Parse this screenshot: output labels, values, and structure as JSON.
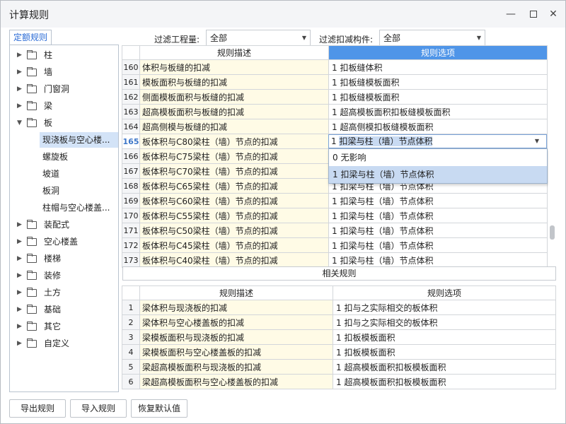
{
  "window": {
    "title": "计算规则",
    "min": "—",
    "close": "✕"
  },
  "tab": "定额规则",
  "filter": {
    "project_label": "过滤工程量:",
    "project_value": "全部",
    "member_label": "过滤扣减构件:",
    "member_value": "全部"
  },
  "tree": {
    "items": [
      "柱",
      "墙",
      "门窗洞",
      "梁",
      "板",
      "装配式",
      "空心楼盖",
      "楼梯",
      "装修",
      "土方",
      "基础",
      "其它",
      "自定义"
    ],
    "children": [
      "现浇板与空心楼...",
      "螺旋板",
      "坡道",
      "板洞",
      "柱帽与空心楼盖..."
    ]
  },
  "main_table": {
    "headers": [
      "规则描述",
      "规则选项"
    ],
    "rows": [
      {
        "n": "160",
        "d": "体积与板缝的扣减",
        "o": "1  扣板缝体积"
      },
      {
        "n": "161",
        "d": "模板面积与板缝的扣减",
        "o": "1  扣板缝模板面积"
      },
      {
        "n": "162",
        "d": "侧面模板面积与板缝的扣减",
        "o": "1  扣板缝模板面积"
      },
      {
        "n": "163",
        "d": "超高模板面积与板缝的扣减",
        "o": "1  超高模板面积扣板缝模板面积"
      },
      {
        "n": "164",
        "d": "超高侧模与板缝的扣减",
        "o": "1  超高侧模扣板缝模板面积"
      },
      {
        "n": "165",
        "d": "板体积与C80梁柱（墙）节点的扣减",
        "o": ""
      },
      {
        "n": "166",
        "d": "板体积与C75梁柱（墙）节点的扣减",
        "o": ""
      },
      {
        "n": "167",
        "d": "板体积与C70梁柱（墙）节点的扣减",
        "o": ""
      },
      {
        "n": "168",
        "d": "板体积与C65梁柱（墙）节点的扣减",
        "o": "1  扣梁与柱（墙）节点体积"
      },
      {
        "n": "169",
        "d": "板体积与C60梁柱（墙）节点的扣减",
        "o": "1  扣梁与柱（墙）节点体积"
      },
      {
        "n": "170",
        "d": "板体积与C55梁柱（墙）节点的扣减",
        "o": "1  扣梁与柱（墙）节点体积"
      },
      {
        "n": "171",
        "d": "板体积与C50梁柱（墙）节点的扣减",
        "o": "1  扣梁与柱（墙）节点体积"
      },
      {
        "n": "172",
        "d": "板体积与C45梁柱（墙）节点的扣减",
        "o": "1  扣梁与柱（墙）节点体积"
      },
      {
        "n": "173",
        "d": "板体积与C40梁柱（墙）节点的扣减",
        "o": "1  扣梁与柱（墙）节点体积"
      }
    ]
  },
  "combo": {
    "prefix": "1 ",
    "value": "扣梁与柱（墙）节点体积"
  },
  "dropdown": {
    "options": [
      "0  无影响",
      "1 扣梁与柱（墙）节点体积"
    ]
  },
  "related_label": "相关规则",
  "related_table": {
    "headers": [
      "规则描述",
      "规则选项"
    ],
    "rows": [
      {
        "n": "1",
        "d": "梁体积与现浇板的扣减",
        "o": "1  扣与之实际相交的板体积"
      },
      {
        "n": "2",
        "d": "梁体积与空心楼盖板的扣减",
        "o": "1  扣与之实际相交的板体积"
      },
      {
        "n": "3",
        "d": "梁模板面积与现浇板的扣减",
        "o": "1  扣板模板面积"
      },
      {
        "n": "4",
        "d": "梁模板面积与空心楼盖板的扣减",
        "o": "1  扣板模板面积"
      },
      {
        "n": "5",
        "d": "梁超高模板面积与现浇板的扣减",
        "o": "1  超高模板面积扣板模板面积"
      },
      {
        "n": "6",
        "d": "梁超高模板面积与空心楼盖板的扣减",
        "o": "1  超高模板面积扣板模板面积"
      }
    ]
  },
  "buttons": {
    "export": "导出规则",
    "import": "导入规则",
    "restore": "恢复默认值"
  },
  "colors": {
    "accent": "#4f95e8",
    "desc_bg": "#fffbe6",
    "selection": "#c8daf2"
  }
}
